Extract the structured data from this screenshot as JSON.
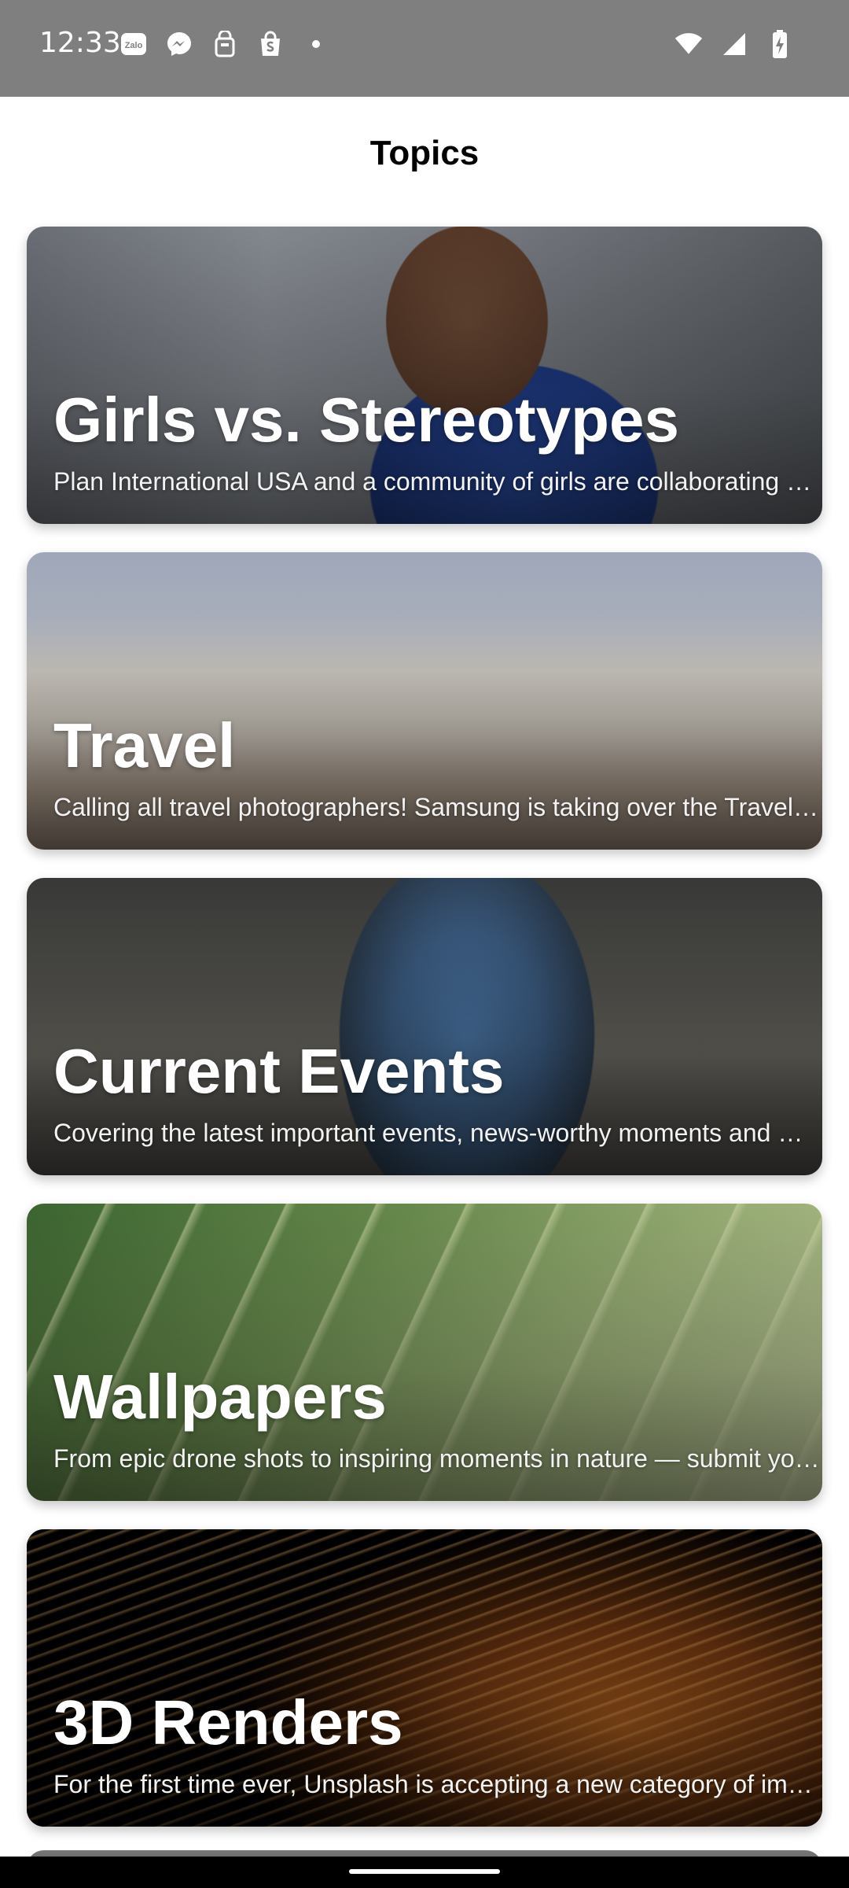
{
  "status_bar": {
    "time": "12:33",
    "left_icons": [
      "zalo-icon",
      "messenger-icon",
      "bag-icon",
      "shopee-icon",
      "dot-icon"
    ],
    "right_icons": [
      "wifi-icon",
      "cellular-signal-icon",
      "battery-charging-icon"
    ],
    "zalo_label": "Zalo"
  },
  "header": {
    "title": "Topics"
  },
  "topics": [
    {
      "title": "Girls vs. Stereotypes",
      "description": "Plan International USA and a community of girls are collaborating …"
    },
    {
      "title": "Travel",
      "description": "Calling all travel photographers! Samsung is taking over the Travel …"
    },
    {
      "title": "Current Events",
      "description": "Covering the latest important events, news-worthy moments and …"
    },
    {
      "title": "Wallpapers",
      "description": "From epic drone shots to inspiring moments in nature — submit yo…"
    },
    {
      "title": "3D Renders",
      "description": "For the first time ever, Unsplash is accepting a new category of ima…"
    }
  ]
}
